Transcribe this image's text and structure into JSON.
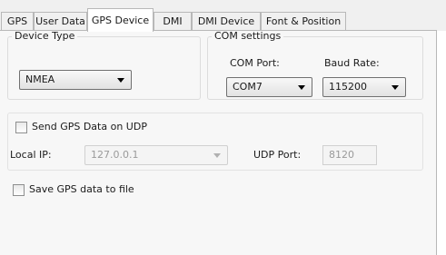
{
  "tabs": [
    {
      "label": "GPS",
      "active": false
    },
    {
      "label": "User Data",
      "active": false
    },
    {
      "label": "GPS Device",
      "active": true
    },
    {
      "label": "DMI",
      "active": false
    },
    {
      "label": "DMI Device",
      "active": false
    },
    {
      "label": "Font & Position",
      "active": false
    }
  ],
  "device_type": {
    "group_title": "Device Type",
    "selected": "NMEA"
  },
  "com_settings": {
    "group_title": "COM settings",
    "port_label": "COM Port:",
    "port_value": "COM7",
    "baud_label": "Baud Rate:",
    "baud_value": "115200"
  },
  "udp": {
    "send_label": "Send GPS Data on UDP",
    "send_checked": false,
    "local_ip_label": "Local IP:",
    "local_ip_value": "127.0.0.1",
    "port_label": "UDP Port:",
    "port_value": "8120"
  },
  "save_file": {
    "label": "Save GPS data to file",
    "checked": false
  }
}
